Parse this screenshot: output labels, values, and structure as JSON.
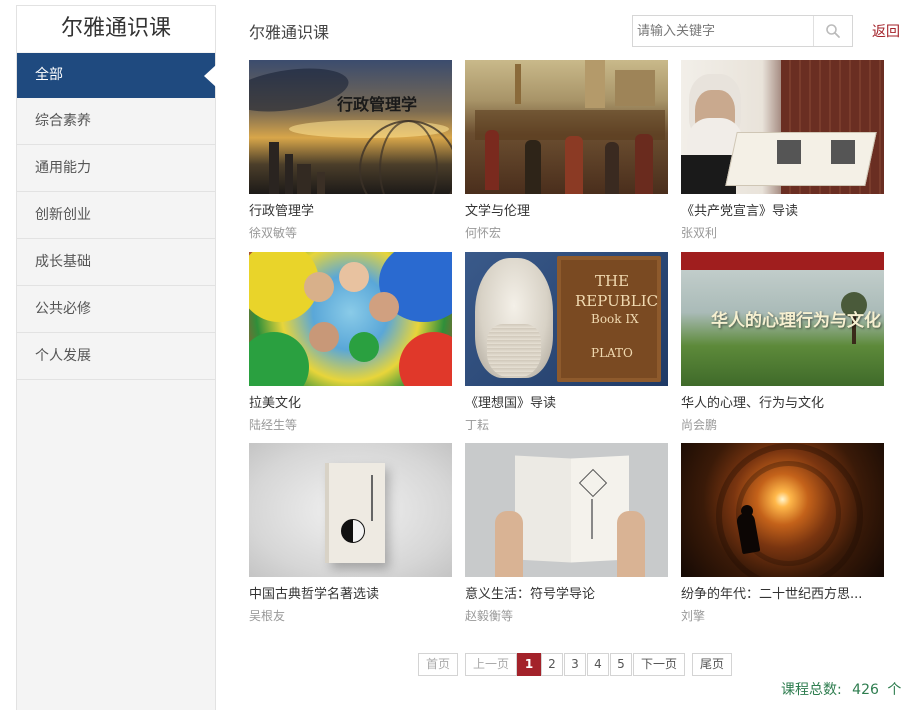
{
  "sidebar": {
    "title": "尔雅通识课",
    "items": [
      {
        "label": "全部"
      },
      {
        "label": "综合素养"
      },
      {
        "label": "通用能力"
      },
      {
        "label": "创新创业"
      },
      {
        "label": "成长基础"
      },
      {
        "label": "公共必修"
      },
      {
        "label": "个人发展"
      }
    ]
  },
  "header": {
    "title": "尔雅通识课",
    "search_placeholder": "请输入关键字",
    "back_label": "返回"
  },
  "courses": [
    {
      "title": "行政管理学",
      "author": "徐双敏等",
      "cover_text": "行政管理学"
    },
    {
      "title": "文学与伦理",
      "author": "何怀宏"
    },
    {
      "title": "《共产党宣言》导读",
      "author": "张双利"
    },
    {
      "title": "拉美文化",
      "author": "陆经生等"
    },
    {
      "title": "《理想国》导读",
      "author": "丁耘",
      "cover_text": {
        "line1": "THE",
        "line2": "REPUBLIC",
        "line3": "Book IX",
        "line4": "PLATO"
      }
    },
    {
      "title": "华人的心理、行为与文化",
      "author": "尚会鹏",
      "cover_text": "华人的心理行为与文化"
    },
    {
      "title": "中国古典哲学名著选读",
      "author": "吴根友"
    },
    {
      "title": "意义生活：符号学导论",
      "author": "赵毅衡等"
    },
    {
      "title": "纷争的年代：二十世纪西方思...",
      "author": "刘擎"
    }
  ],
  "pagination": {
    "first": "首页",
    "prev": "上一页",
    "pages": [
      "1",
      "2",
      "3",
      "4",
      "5"
    ],
    "current": "1",
    "next": "下一页",
    "last": "尾页"
  },
  "total": {
    "label": "课程总数:",
    "count": "426",
    "unit": "个"
  },
  "colors": {
    "accent": "#1f4a7f",
    "brand_red": "#a3222a",
    "total_green": "#2e7d4f"
  }
}
